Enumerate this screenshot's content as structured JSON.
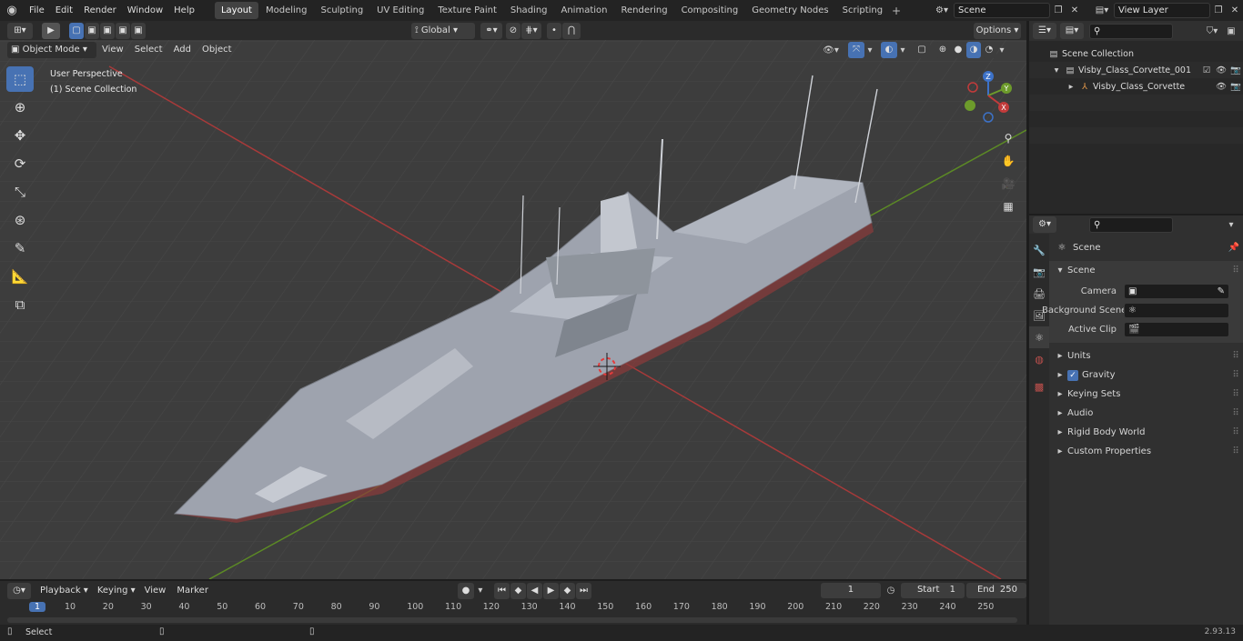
{
  "topbar": {
    "menus": [
      "File",
      "Edit",
      "Render",
      "Window",
      "Help"
    ],
    "workspaces": [
      "Layout",
      "Modeling",
      "Sculpting",
      "UV Editing",
      "Texture Paint",
      "Shading",
      "Animation",
      "Rendering",
      "Compositing",
      "Geometry Nodes",
      "Scripting"
    ],
    "active_workspace": "Layout",
    "scene": "Scene",
    "view_layer": "View Layer"
  },
  "viewport_header": {
    "transform_orientation": "Global",
    "options_label": "Options",
    "mode": "Object Mode",
    "menus": [
      "View",
      "Select",
      "Add",
      "Object"
    ]
  },
  "viewport": {
    "perspective": "User Perspective",
    "collection_info": "(1) Scene Collection",
    "gizmo_axes": {
      "x": "X",
      "y": "Y",
      "z": "Z"
    }
  },
  "outliner": {
    "root": "Scene Collection",
    "collection": "Visby_Class_Corvette_001",
    "object": "Visby_Class_Corvette"
  },
  "properties": {
    "context": "Scene",
    "panel": "Scene",
    "fields": [
      {
        "label": "Camera",
        "value": ""
      },
      {
        "label": "Background Scene",
        "value": ""
      },
      {
        "label": "Active Clip",
        "value": ""
      }
    ],
    "sections": [
      "Units",
      "Gravity",
      "Keying Sets",
      "Audio",
      "Rigid Body World",
      "Custom Properties"
    ],
    "gravity_enabled": true
  },
  "timeline": {
    "menus": [
      "Playback",
      "Keying",
      "View",
      "Marker"
    ],
    "current_frame": "1",
    "start_label": "Start",
    "start": "1",
    "end_label": "End",
    "end": "250",
    "ticks": [
      "1",
      "10",
      "20",
      "30",
      "40",
      "50",
      "60",
      "70",
      "80",
      "90",
      "100",
      "110",
      "120",
      "130",
      "140",
      "150",
      "160",
      "170",
      "180",
      "190",
      "200",
      "210",
      "220",
      "230",
      "240",
      "250"
    ]
  },
  "statusbar": {
    "left": "Select",
    "version": "2.93.13"
  },
  "colors": {
    "accent": "#4772b3",
    "x_axis": "#c23b3b",
    "y_axis": "#6d9b2b",
    "z_axis": "#3d72c8",
    "bg": "#3d3d3d"
  },
  "icons": {
    "blender": "blender-logo-icon",
    "select": "select-box-icon",
    "cursor": "cursor-icon",
    "move": "move-icon",
    "rotate": "rotate-icon",
    "scale": "scale-icon",
    "transform": "transform-icon",
    "annotate": "annotate-icon",
    "measure": "measure-icon",
    "add_cube": "add-cube-icon"
  }
}
